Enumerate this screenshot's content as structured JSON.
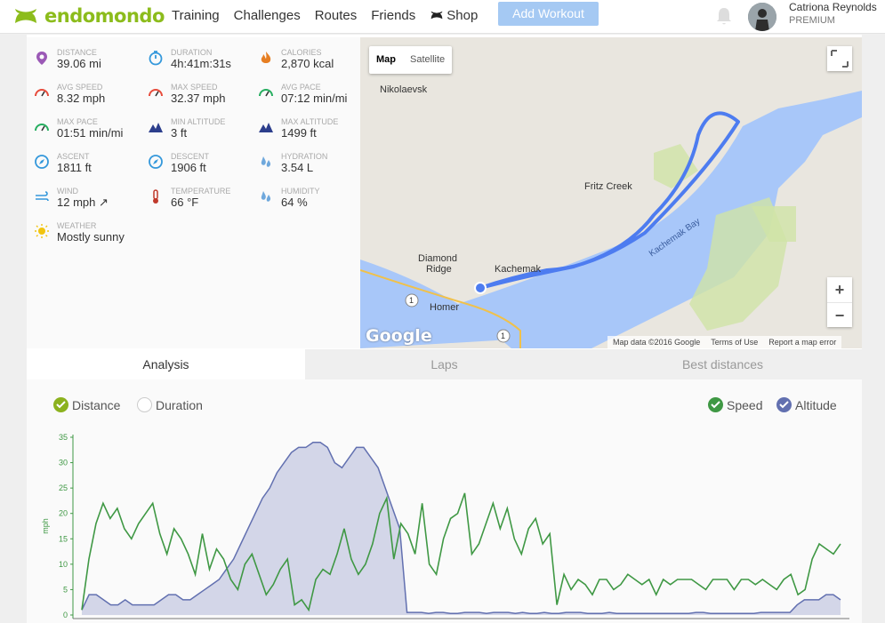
{
  "header": {
    "brand": "endomondo",
    "nav": [
      "Training",
      "Challenges",
      "Routes",
      "Friends",
      "Shop"
    ],
    "add_workout": "Add Workout",
    "user_name": "Catriona Reynolds",
    "user_tier": "PREMIUM"
  },
  "stats": [
    {
      "label": "DISTANCE",
      "value": "39.06 mi",
      "icon": "pin-icon",
      "color": "#9b59b6"
    },
    {
      "label": "DURATION",
      "value": "4h:41m:31s",
      "icon": "stopwatch-icon",
      "color": "#3498db"
    },
    {
      "label": "CALORIES",
      "value": "2,870 kcal",
      "icon": "flame-icon",
      "color": "#e67e22"
    },
    {
      "label": "AVG SPEED",
      "value": "8.32 mph",
      "icon": "speedometer-icon",
      "color": "#e74c3c"
    },
    {
      "label": "MAX SPEED",
      "value": "32.37 mph",
      "icon": "speedometer-icon",
      "color": "#e74c3c"
    },
    {
      "label": "AVG PACE",
      "value": "07:12 min/mi",
      "icon": "speedometer-icon",
      "color": "#27ae60"
    },
    {
      "label": "MAX PACE",
      "value": "01:51 min/mi",
      "icon": "speedometer-icon",
      "color": "#27ae60"
    },
    {
      "label": "MIN ALTITUDE",
      "value": "3 ft",
      "icon": "mountain-icon",
      "color": "#2c3e8c"
    },
    {
      "label": "MAX ALTITUDE",
      "value": "1499 ft",
      "icon": "mountain-icon",
      "color": "#2c3e8c"
    },
    {
      "label": "ASCENT",
      "value": "1811 ft",
      "icon": "compass-icon",
      "color": "#3498db"
    },
    {
      "label": "DESCENT",
      "value": "1906 ft",
      "icon": "compass-icon",
      "color": "#3498db"
    },
    {
      "label": "HYDRATION",
      "value": "3.54 L",
      "icon": "drops-icon",
      "color": "#6fa8dc"
    },
    {
      "label": "WIND",
      "value": "12 mph ↗",
      "icon": "wind-icon",
      "color": "#3498db"
    },
    {
      "label": "TEMPERATURE",
      "value": "66 °F",
      "icon": "thermometer-icon",
      "color": "#c0392b"
    },
    {
      "label": "HUMIDITY",
      "value": "64 %",
      "icon": "drops-icon",
      "color": "#6fa8dc"
    },
    {
      "label": "WEATHER",
      "value": "Mostly sunny",
      "icon": "sun-icon",
      "color": "#f1c40f"
    }
  ],
  "map": {
    "type_map": "Map",
    "type_satellite": "Satellite",
    "places": [
      "Nikolaevsk",
      "Fritz Creek",
      "Diamond",
      "Ridge",
      "Kachemak",
      "Homer",
      "Kachemak Bay"
    ],
    "attribution": [
      "Map data ©2016 Google",
      "Terms of Use",
      "Report a map error"
    ],
    "logo": "Google",
    "road_shield": "1"
  },
  "tabs": [
    "Analysis",
    "Laps",
    "Best distances"
  ],
  "toggles": {
    "distance": "Distance",
    "duration": "Duration",
    "speed": "Speed",
    "altitude": "Altitude"
  },
  "chart_data": {
    "type": "line",
    "ylabel": "mph",
    "ylim": [
      0,
      35
    ],
    "yticks": [
      0,
      5,
      10,
      15,
      20,
      25,
      30,
      35
    ],
    "series": [
      {
        "name": "Speed",
        "color": "#3f9844",
        "values": [
          1,
          11,
          18,
          22,
          19,
          21,
          17,
          15,
          18,
          20,
          22,
          16,
          12,
          17,
          15,
          12,
          8,
          16,
          9,
          13,
          11,
          7,
          5,
          10,
          12,
          8,
          4,
          6,
          9,
          11,
          2,
          3,
          1,
          7,
          9,
          8,
          12,
          17,
          11,
          8,
          10,
          14,
          20,
          23,
          11,
          18,
          16,
          12,
          22,
          10,
          8,
          15,
          19,
          20,
          24,
          12,
          14,
          18,
          22,
          17,
          21,
          15,
          12,
          17,
          19,
          14,
          16,
          2,
          8,
          5,
          7,
          6,
          4,
          7,
          7,
          5,
          6,
          8,
          7,
          6,
          7,
          4,
          7,
          6,
          7,
          7,
          7,
          6,
          5,
          7,
          7,
          7,
          5,
          7,
          7,
          6,
          7,
          6,
          5,
          7,
          8,
          4,
          5,
          11,
          14,
          13,
          12,
          14
        ]
      },
      {
        "name": "Altitude",
        "color": "#6270b0",
        "values": [
          1,
          4,
          4,
          3,
          2,
          2,
          3,
          2,
          2,
          2,
          2,
          3,
          4,
          4,
          3,
          3,
          4,
          5,
          6,
          7,
          9,
          11,
          14,
          17,
          20,
          23,
          25,
          28,
          30,
          32,
          33,
          33,
          34,
          34,
          33,
          30,
          29,
          31,
          33,
          33,
          31,
          29,
          25,
          21,
          17,
          0.5,
          0.5,
          0.5,
          0.3,
          0.5,
          0.5,
          0.3,
          0.3,
          0.5,
          0.5,
          0.5,
          0.3,
          0.5,
          0.5,
          0.5,
          0.3,
          0.5,
          0.3,
          0.3,
          0.5,
          0.3,
          0.3,
          0.5,
          0.5,
          0.5,
          0.3,
          0.3,
          0.3,
          0.5,
          0.3,
          0.3,
          0.3,
          0.3,
          0.3,
          0.3,
          0.3,
          0.3,
          0.3,
          0.3,
          0.3,
          0.5,
          0.5,
          0.3,
          0.3,
          0.3,
          0.3,
          0.3,
          0.3,
          0.3,
          0.5,
          0.5,
          0.5,
          0.5,
          0.5,
          2,
          3,
          3,
          3,
          4,
          4,
          3
        ]
      }
    ]
  }
}
